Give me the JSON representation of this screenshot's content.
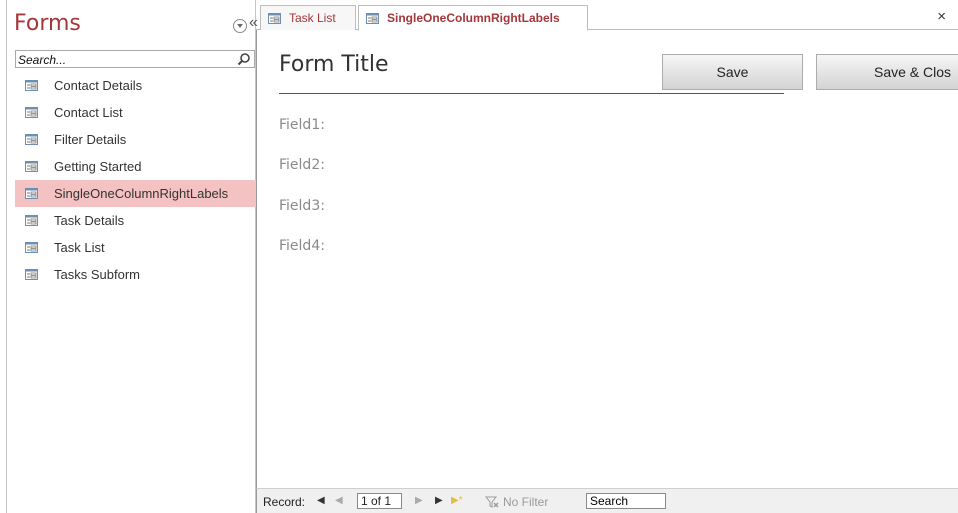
{
  "nav": {
    "title": "Forms",
    "collapse_glyph": "«",
    "search_placeholder": "Search...",
    "items": [
      {
        "label": "Contact Details"
      },
      {
        "label": "Contact List"
      },
      {
        "label": "Filter Details"
      },
      {
        "label": "Getting Started"
      },
      {
        "label": "SingleOneColumnRightLabels"
      },
      {
        "label": "Task Details"
      },
      {
        "label": "Task List"
      },
      {
        "label": "Tasks Subform"
      }
    ],
    "selected_item": "SingleOneColumnRightLabels"
  },
  "tabs": [
    {
      "label": "Task List",
      "active": false
    },
    {
      "label": "SingleOneColumnRightLabels",
      "active": true
    }
  ],
  "close_glyph": "×",
  "form": {
    "title": "Form Title",
    "save_label": "Save",
    "save_close_label": "Save & Clos",
    "fields": [
      {
        "label": "Field1:"
      },
      {
        "label": "Field2:"
      },
      {
        "label": "Field3:"
      },
      {
        "label": "Field4:"
      }
    ]
  },
  "record_nav": {
    "label": "Record:",
    "first_glyph": "◀",
    "prev_glyph": "◀",
    "current": "1 of 1",
    "next_glyph": "▶",
    "last_glyph": "▶",
    "new_glyph": "▶*",
    "filter_label": "No Filter",
    "search_label": "Search"
  },
  "colors": {
    "accent": "#a4373a",
    "selected_bg": "#f4c2c2"
  },
  "icons": {
    "form": "form-icon",
    "search": "search-icon",
    "menu": "chevron-down-icon",
    "filter": "filter-icon"
  }
}
